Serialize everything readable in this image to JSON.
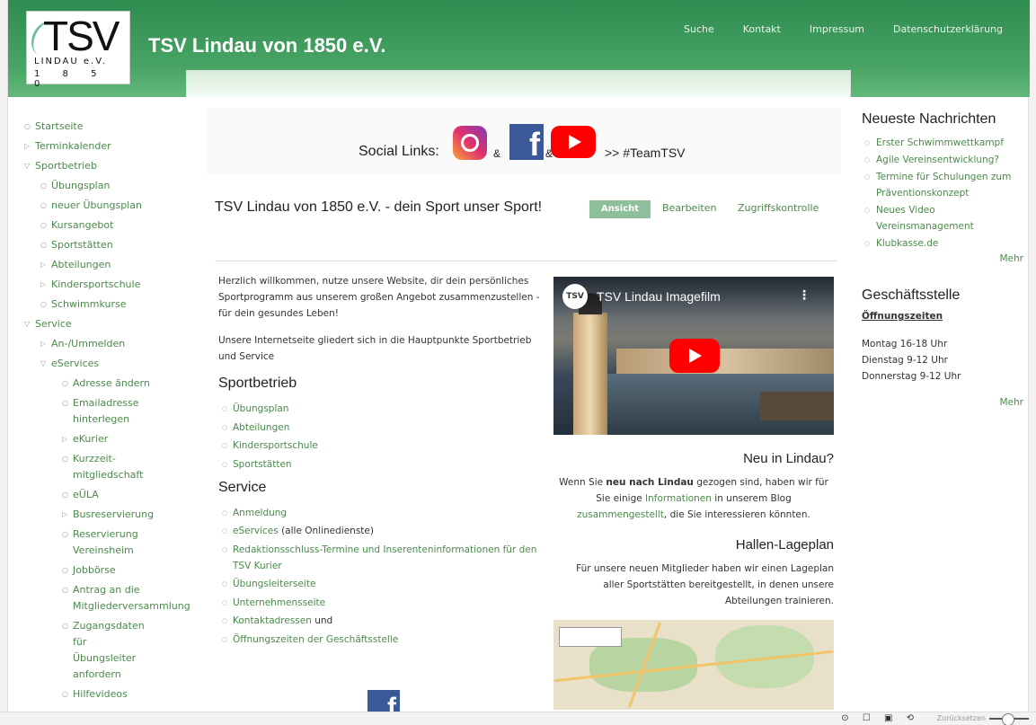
{
  "header": {
    "logo": {
      "tsv": "TSV",
      "lindau": "LINDAU e.V.",
      "year": "1 8 5 0"
    },
    "title": "TSV Lindau von 1850 e.V.",
    "nav": [
      "Suche",
      "Kontakt",
      "Impressum",
      "Datenschutzerklärung"
    ]
  },
  "sidebar": {
    "items": [
      {
        "label": "Startseite",
        "level": 0,
        "bullet": "○"
      },
      {
        "label": "Terminkalender",
        "level": 0,
        "bullet": "▷"
      },
      {
        "label": "Sportbetrieb",
        "level": 0,
        "bullet": "▽"
      },
      {
        "label": "Übungsplan",
        "level": 1,
        "bullet": "○"
      },
      {
        "label": "neuer Übungsplan",
        "level": 1,
        "bullet": "○"
      },
      {
        "label": "Kursangebot",
        "level": 1,
        "bullet": "○"
      },
      {
        "label": "Sportstätten",
        "level": 1,
        "bullet": "○"
      },
      {
        "label": "Abteilungen",
        "level": 1,
        "bullet": "▷"
      },
      {
        "label": "Kindersportschule",
        "level": 1,
        "bullet": "▷"
      },
      {
        "label": "Schwimmkurse",
        "level": 1,
        "bullet": "○"
      },
      {
        "label": "Service",
        "level": 0,
        "bullet": "▽"
      },
      {
        "label": "An-/Ummelden",
        "level": 1,
        "bullet": "▷"
      },
      {
        "label": "eServices",
        "level": 1,
        "bullet": "▽"
      },
      {
        "label": "Adresse ändern",
        "level": 2,
        "bullet": "○"
      },
      {
        "label": "Emailadresse hinterlegen",
        "level": 2,
        "bullet": "○"
      },
      {
        "label": "eKurier",
        "level": 2,
        "bullet": "▷"
      },
      {
        "label": "Kurzzeit-mitgliedschaft",
        "level": 2,
        "bullet": "○"
      },
      {
        "label": "eÜLA",
        "level": 2,
        "bullet": "○"
      },
      {
        "label": "Busreservierung",
        "level": 2,
        "bullet": "▷"
      },
      {
        "label": "Reservierung Vereinsheim",
        "level": 2,
        "bullet": "○"
      },
      {
        "label": "Jobbörse",
        "level": 2,
        "bullet": "○"
      },
      {
        "label": "Antrag an die Mitgliederversammlung",
        "level": 2,
        "bullet": "○"
      },
      {
        "label": "Zugangsdaten für Übungsleiter anfordern",
        "level": 2,
        "bullet": "○"
      },
      {
        "label": "Hilfevideos",
        "level": 2,
        "bullet": "○"
      }
    ]
  },
  "social": {
    "prefix": "Social Links:",
    "amp": "&",
    "hashtag": ">> #TeamTSV",
    "fb_glyph": "f"
  },
  "page": {
    "title": "TSV Lindau von 1850 e.V. - dein Sport unser Sport!",
    "tabs": {
      "view": "Ansicht",
      "edit": "Bearbeiten",
      "access": "Zugriffskontrolle"
    }
  },
  "main": {
    "intro1": "Herzlich willkommen, nutze unsere Website, dir dein persönliches Sportprogramm aus unserem großen Angebot zusammenzustellen - für dein gesundes Leben!",
    "intro2": "Unsere Internetseite gliedert sich in die Hauptpunkte Sportbetrieb und Service",
    "sportbetrieb": {
      "heading": "Sportbetrieb",
      "links": [
        "Übungsplan",
        "Abteilungen",
        "Kindersportschule",
        "Sportstätten"
      ]
    },
    "service": {
      "heading": "Service",
      "links": [
        {
          "label": "Anmeldung",
          "suffix": ""
        },
        {
          "label": "eServices",
          "suffix": " (alle Onlinedienste)"
        },
        {
          "label": "Redaktionsschluss-Termine und Inserenteninformationen für den TSV Kurier",
          "suffix": ""
        },
        {
          "label": "Übungsleiterseite",
          "suffix": ""
        },
        {
          "label": "Unternehmensseite",
          "suffix": ""
        },
        {
          "label": "Kontaktadressen",
          "suffix": " und"
        },
        {
          "label": "Öffnungszeiten der Geschäftsstelle",
          "suffix": ""
        }
      ]
    }
  },
  "video": {
    "channel": "TSV",
    "title": "TSV Lindau Imagefilm",
    "menu": "⋮"
  },
  "neu": {
    "heading": "Neu in Lindau?",
    "t1": "Wenn Sie ",
    "bold": "neu nach Lindau",
    "t2": " gezogen sind, haben wir für Sie einige ",
    "link1": "Informationen",
    "t3": " in unserem Blog ",
    "link2": "zusammengestellt",
    "t4": ", die Sie interessieren könnten."
  },
  "hallen": {
    "heading": "Hallen-Lageplan",
    "text": "Für unsere neuen Mitglieder haben wir einen Lageplan aller Sportstätten bereitgestellt, in denen unsere Abteilungen trainieren."
  },
  "news": {
    "heading": "Neueste Nachrichten",
    "items": [
      "Erster Schwimmwettkampf",
      "Agile Vereinsentwicklung?",
      "Termine für Schulungen zum Präventionskonzept",
      "Neues Video Vereinsmanagement",
      "Klubkasse.de"
    ],
    "more": "Mehr"
  },
  "office": {
    "heading": "Geschäftsstelle",
    "hours_label": "Öffnungszeiten",
    "hours": [
      "Montag 16-18 Uhr",
      "Dienstag 9-12 Uhr",
      "Donnerstag 9-12 Uhr"
    ],
    "more": "Mehr"
  },
  "statusbar": {
    "icons": "⊙ ☐ ▣ ⟲",
    "reset": "Zurücksetzen"
  }
}
